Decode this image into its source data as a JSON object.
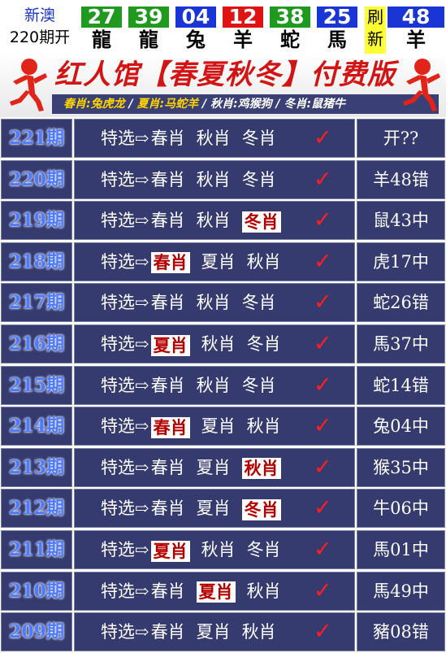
{
  "header": {
    "site_line1": "新澳",
    "site_line2": "220期开",
    "balls": [
      {
        "num": "27",
        "zodiac": "龍",
        "color": "#1f9a1f"
      },
      {
        "num": "39",
        "zodiac": "龍",
        "color": "#1f9a1f"
      },
      {
        "num": "04",
        "zodiac": "兔",
        "color": "#1a35d6"
      },
      {
        "num": "12",
        "zodiac": "羊",
        "color": "#e01313"
      },
      {
        "num": "38",
        "zodiac": "蛇",
        "color": "#1f9a1f"
      },
      {
        "num": "25",
        "zodiac": "馬",
        "color": "#1a35d6"
      }
    ],
    "refresh_line1": "刷",
    "refresh_line2": "新",
    "special": {
      "num": "48",
      "zodiac": "羊",
      "color": "#1a35d6"
    }
  },
  "banner": {
    "title": "红人馆【春夏秋冬】付费版",
    "spring": "春肖:兔虎龙",
    "summer": "夏肖:马蛇羊",
    "autumn": "秋肖:鸡猴狗",
    "winter": "冬肖:鼠猪牛",
    "sep": "/"
  },
  "pick_prefix": "特选⇨",
  "check_mark": "✓",
  "rows": [
    {
      "period": "221期",
      "p1": "春肖",
      "p2": "秋肖",
      "p3": "冬肖",
      "hit": 0,
      "result": "开??"
    },
    {
      "period": "220期",
      "p1": "春肖",
      "p2": "秋肖",
      "p3": "冬肖",
      "hit": 0,
      "result": "羊48错"
    },
    {
      "period": "219期",
      "p1": "春肖",
      "p2": "秋肖",
      "p3": "冬肖",
      "hit": 3,
      "result": "鼠43中"
    },
    {
      "period": "218期",
      "p1": "春肖",
      "p2": "夏肖",
      "p3": "秋肖",
      "hit": 1,
      "result": "虎17中"
    },
    {
      "period": "217期",
      "p1": "春肖",
      "p2": "秋肖",
      "p3": "冬肖",
      "hit": 0,
      "result": "蛇26错"
    },
    {
      "period": "216期",
      "p1": "夏肖",
      "p2": "秋肖",
      "p3": "冬肖",
      "hit": 1,
      "result": "馬37中"
    },
    {
      "period": "215期",
      "p1": "春肖",
      "p2": "秋肖",
      "p3": "冬肖",
      "hit": 0,
      "result": "蛇14错"
    },
    {
      "period": "214期",
      "p1": "春肖",
      "p2": "夏肖",
      "p3": "秋肖",
      "hit": 1,
      "result": "兔04中"
    },
    {
      "period": "213期",
      "p1": "春肖",
      "p2": "夏肖",
      "p3": "秋肖",
      "hit": 3,
      "result": "猴35中"
    },
    {
      "period": "212期",
      "p1": "春肖",
      "p2": "夏肖",
      "p3": "冬肖",
      "hit": 3,
      "result": "牛06中"
    },
    {
      "period": "211期",
      "p1": "夏肖",
      "p2": "秋肖",
      "p3": "冬肖",
      "hit": 1,
      "result": "馬01中"
    },
    {
      "period": "210期",
      "p1": "春肖",
      "p2": "夏肖",
      "p3": "秋肖",
      "hit": 2,
      "result": "馬49中"
    },
    {
      "period": "209期",
      "p1": "春肖",
      "p2": "夏肖",
      "p3": "秋肖",
      "hit": 0,
      "result": "豬08错"
    }
  ]
}
